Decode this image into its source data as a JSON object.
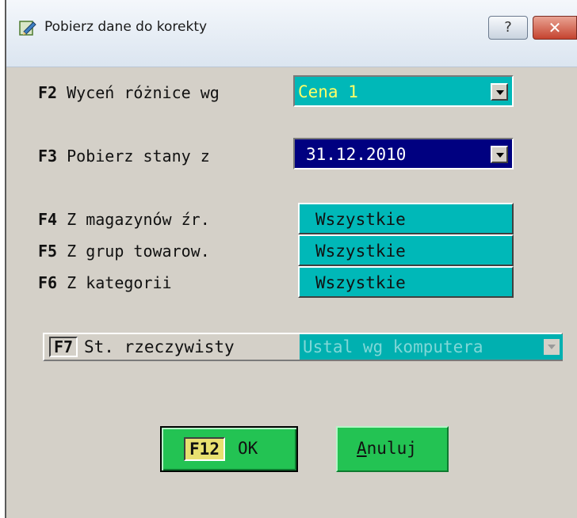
{
  "window": {
    "title": "Pobierz dane do korekty",
    "help_button": "?",
    "close_button": "✕"
  },
  "f2": {
    "key": "F2",
    "label": " Wyceń różnice wg",
    "value": "Cena 1",
    "bg_color": "#00b8b8",
    "text_color": "#ffff66"
  },
  "f3": {
    "key": "F3",
    "label": " Pobierz stany z",
    "value": "31.12.2010",
    "bg_color": "#000080",
    "text_color": "#ffffff"
  },
  "f4": {
    "key": "F4",
    "label": " Z magazynów źr.",
    "value": "Wszystkie"
  },
  "f5": {
    "key": "F5",
    "label": " Z grup towarow.",
    "value": "Wszystkie"
  },
  "f6": {
    "key": "F6",
    "label": " Z kategorii",
    "value": "Wszystkie"
  },
  "f7": {
    "key": "F7",
    "label": "St. rzeczywisty",
    "value": "Ustal wg komputera",
    "disabled": true
  },
  "buttons": {
    "ok_key": "F12",
    "ok_label": "OK",
    "cancel_mnemonic": "A",
    "cancel_rest": "nuluj"
  }
}
